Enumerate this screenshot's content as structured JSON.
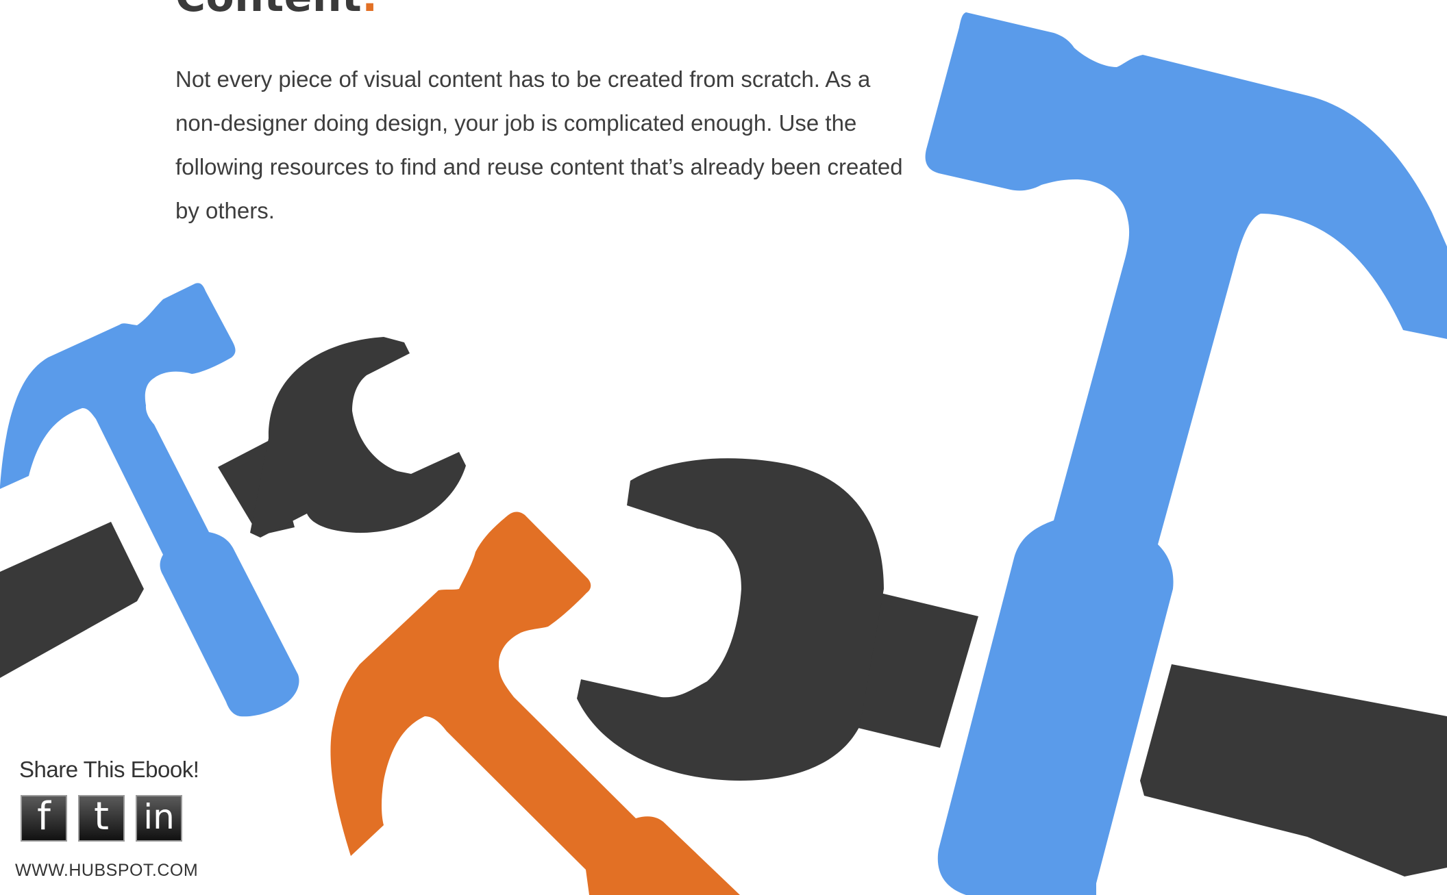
{
  "page": {
    "title_word": "Content",
    "title_punct": ".",
    "body": "Not every piece of visual content has to be created from scratch. As a non-designer doing design, your job is complicated enough. Use the following resources to find and reuse content that’s already been created by others."
  },
  "share": {
    "label": "Share This Ebook!",
    "icons": [
      {
        "name": "facebook-icon",
        "glyph": "f"
      },
      {
        "name": "twitter-icon",
        "glyph": "t"
      },
      {
        "name": "linkedin-icon",
        "glyph": "in"
      }
    ]
  },
  "footer": {
    "site": "WWW.HUBSPOT.COM"
  },
  "colors": {
    "blue": "#5a9bea",
    "dark": "#393939",
    "orange": "#e27025",
    "text": "#3d3d3d"
  }
}
